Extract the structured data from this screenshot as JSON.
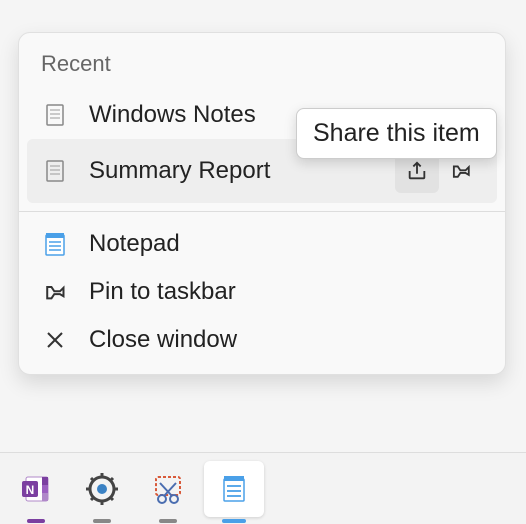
{
  "jumplist": {
    "section_header": "Recent",
    "recent_items": [
      {
        "label": "Windows Notes",
        "icon": "document-icon"
      },
      {
        "label": "Summary Report",
        "icon": "document-icon"
      }
    ],
    "app_item": {
      "label": "Notepad",
      "icon": "notepad-icon"
    },
    "tasks": [
      {
        "label": "Pin to taskbar",
        "icon": "pin-icon"
      },
      {
        "label": "Close window",
        "icon": "close-icon"
      }
    ],
    "tooltip": "Share this item"
  },
  "taskbar": {
    "items": [
      {
        "name": "onenote-icon",
        "indicator_color": "#7b3fa0"
      },
      {
        "name": "settings-icon",
        "indicator_color": "#888"
      },
      {
        "name": "snipping-tool-icon",
        "indicator_color": "#888"
      },
      {
        "name": "notepad-icon",
        "indicator_color": "#4aa0e8",
        "active": true
      }
    ]
  }
}
